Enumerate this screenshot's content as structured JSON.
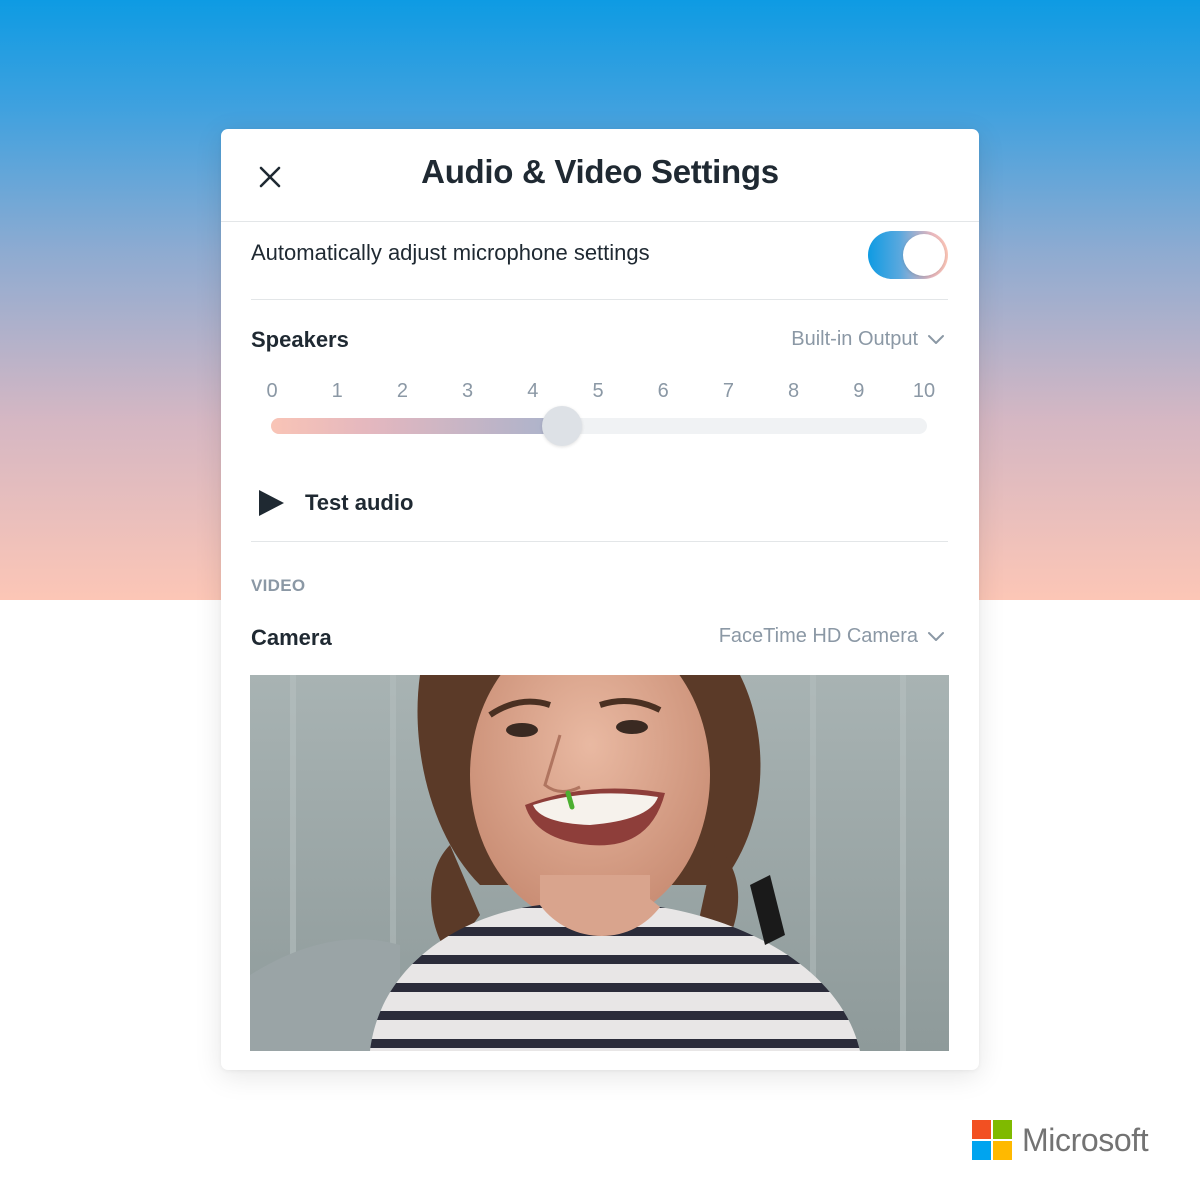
{
  "dialog": {
    "title": "Audio & Video Settings",
    "close_icon": "close-icon"
  },
  "auto_adjust": {
    "label": "Automatically adjust microphone settings",
    "enabled": true
  },
  "speakers": {
    "label": "Speakers",
    "device": "Built-in Output",
    "ticks": [
      "0",
      "1",
      "2",
      "3",
      "4",
      "5",
      "6",
      "7",
      "8",
      "9",
      "10"
    ],
    "volume": 4.4,
    "min": 0,
    "max": 10
  },
  "test_audio": {
    "label": "Test audio",
    "icon": "play-icon"
  },
  "video": {
    "section_label": "VIDEO",
    "camera_label": "Camera",
    "camera_device": "FaceTime HD Camera"
  },
  "brand": {
    "name": "Microsoft"
  },
  "colors": {
    "accent_blue": "#0e9be3",
    "accent_peach": "#fcc6b6",
    "text_dark": "#1f2932",
    "text_muted": "#8b98a5",
    "ms_red": "#f25022",
    "ms_green": "#7fba00",
    "ms_blue": "#00a4ef",
    "ms_yellow": "#ffb900"
  }
}
